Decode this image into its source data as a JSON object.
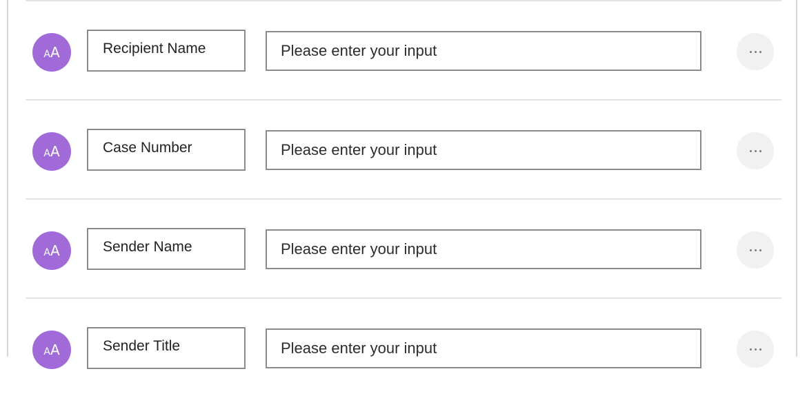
{
  "fields": [
    {
      "label": "Recipient Name",
      "placeholder": "Please enter your input",
      "avatar_icon": "font-size-icon"
    },
    {
      "label": "Case Number",
      "placeholder": "Please enter your input",
      "avatar_icon": "font-size-icon"
    },
    {
      "label": "Sender Name",
      "placeholder": "Please enter your input",
      "avatar_icon": "font-size-icon"
    },
    {
      "label": "Sender Title",
      "placeholder": "Please enter your input",
      "avatar_icon": "font-size-icon"
    }
  ],
  "avatar_glyph_small": "A",
  "avatar_glyph_big": "A",
  "colors": {
    "avatar": "#a06bd8",
    "more_button_bg": "#f1f1f1",
    "border": "#8a8a8a",
    "divider": "#e3e3e3"
  }
}
